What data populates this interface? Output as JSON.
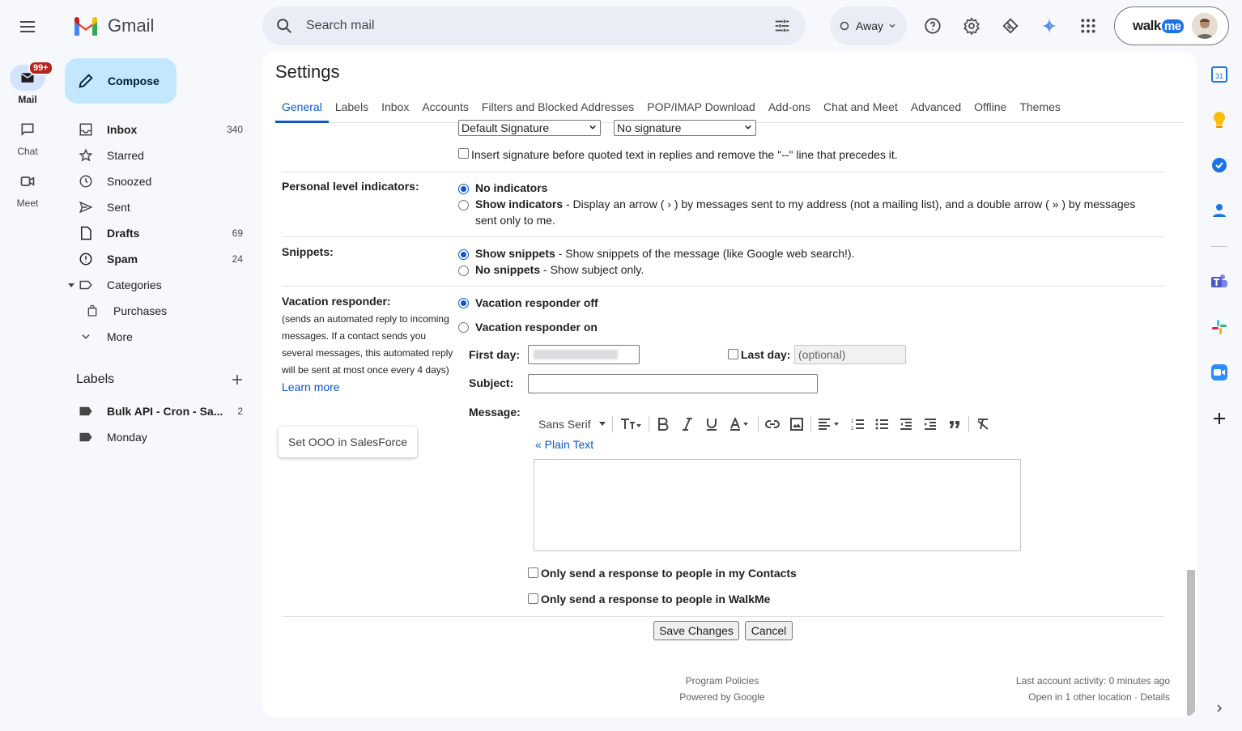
{
  "app": {
    "logo_text": "Gmail"
  },
  "rail": [
    {
      "label": "Mail",
      "badge": "99+",
      "icon": "mail-icon"
    },
    {
      "label": "Chat",
      "icon": "chat-icon"
    },
    {
      "label": "Meet",
      "icon": "meet-icon"
    }
  ],
  "compose_label": "Compose",
  "nav": [
    {
      "label": "Inbox",
      "count": "340",
      "icon": "inbox-icon",
      "bold": true
    },
    {
      "label": "Starred",
      "count": "",
      "icon": "star-icon",
      "bold": false
    },
    {
      "label": "Snoozed",
      "count": "",
      "icon": "clock-icon",
      "bold": false
    },
    {
      "label": "Sent",
      "count": "",
      "icon": "send-icon",
      "bold": false
    },
    {
      "label": "Drafts",
      "count": "69",
      "icon": "draft-icon",
      "bold": true
    },
    {
      "label": "Spam",
      "count": "24",
      "icon": "spam-icon",
      "bold": true
    },
    {
      "label": "Categories",
      "count": "",
      "icon": "label-outline-icon",
      "bold": false
    },
    {
      "label": "Purchases",
      "count": "",
      "icon": "shopping-bag-icon",
      "bold": false
    },
    {
      "label": "More",
      "count": "",
      "icon": "chevron-down-icon",
      "bold": false
    }
  ],
  "labels_heading": "Labels",
  "labels": [
    {
      "label": "Bulk API - Cron - Sa...",
      "count": "2",
      "bold": true
    },
    {
      "label": "Monday",
      "count": "",
      "bold": false
    }
  ],
  "search": {
    "placeholder": "Search mail"
  },
  "status": {
    "label": "Away"
  },
  "account": {
    "brand": "walk",
    "brand_me": "me"
  },
  "settings": {
    "title": "Settings",
    "tabs": [
      "General",
      "Labels",
      "Inbox",
      "Accounts",
      "Filters and Blocked Addresses",
      "POP/IMAP Download",
      "Add-ons",
      "Chat and Meet",
      "Advanced",
      "Offline",
      "Themes"
    ],
    "active_tab": "General",
    "signature": {
      "select1": "Default Signature",
      "select2": "No signature",
      "insert_before": "Insert signature before quoted text in replies and remove the \"--\" line that precedes it."
    },
    "personal_indicators": {
      "label": "Personal level indicators:",
      "opt1": "No indicators",
      "opt2_bold": "Show indicators",
      "opt2_text": " - Display an arrow ( › ) by messages sent to my address (not a mailing list), and a double arrow ( » ) by messages",
      "opt2_text2": "sent only to me.",
      "selected": "No indicators"
    },
    "snippets": {
      "label": "Snippets:",
      "opt1_bold": "Show snippets",
      "opt1_text": " - Show snippets of the message (like Google web search!).",
      "opt2_bold": "No snippets",
      "opt2_text": " - Show subject only.",
      "selected": "Show snippets"
    },
    "vacation": {
      "label": "Vacation responder:",
      "description": "(sends an automated reply to incoming messages. If a contact sends you several messages, this automated reply will be sent at most once every 4 days)",
      "learn_more": "Learn more",
      "off": "Vacation responder off",
      "on": "Vacation responder on",
      "selected": "Vacation responder off",
      "first_day_label": "First day:",
      "last_day_label": "Last day:",
      "last_day_placeholder": "(optional)",
      "subject_label": "Subject:",
      "message_label": "Message:",
      "font": "Sans Serif",
      "plain_text": "« Plain Text",
      "only_contacts": "Only send a response to people in my Contacts",
      "only_org": "Only send a response to people in WalkMe"
    },
    "save": "Save Changes",
    "cancel": "Cancel",
    "tooltip": "Set OOO in SalesForce",
    "footer": {
      "policies": "Program Policies",
      "powered": "Powered by Google",
      "activity": "Last account activity: 0 minutes ago",
      "location": "Open in 1 other location · Details"
    }
  },
  "colors": {
    "accent": "#0b57d0",
    "compose_bg": "#c2e7ff",
    "badge": "#b3261e",
    "background": "#f6f8fc"
  }
}
